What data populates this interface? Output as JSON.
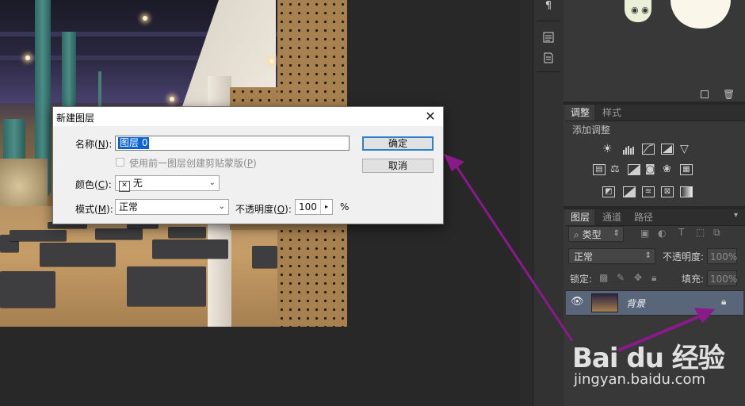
{
  "dialog": {
    "title": "新建图层",
    "name_label": "名称(",
    "name_key": "N",
    "name_label_end": "):",
    "name_value": "图层 0",
    "clip_label": "使用前一图层创建剪贴蒙版(",
    "clip_key": "P",
    "clip_label_end": ")",
    "color_label": "颜色(",
    "color_key": "C",
    "color_label_end": "):",
    "color_value": "无",
    "color_x": "✕",
    "mode_label": "模式(",
    "mode_key": "M",
    "mode_label_end": "):",
    "mode_value": "正常",
    "opacity_label": "不透明度(",
    "opacity_key": "O",
    "opacity_label_end": "):",
    "opacity_value": "100",
    "opacity_unit": "%",
    "ok_label": "确定",
    "cancel_label": "取消",
    "close_glyph": "✕"
  },
  "adjustments_panel": {
    "tabs": [
      "调整",
      "样式"
    ],
    "hint": "添加调整"
  },
  "layers_panel": {
    "tabs": [
      "图层",
      "通道",
      "路径"
    ],
    "filter_kind": "类型",
    "blend_mode": "正常",
    "opacity_label": "不透明度:",
    "opacity_value": "100%",
    "lock_label": "锁定:",
    "fill_label": "填充:",
    "fill_value": "100%",
    "layer_name": "背景"
  },
  "watermark": {
    "logo": "Bai du 经验",
    "url": "jingyan.baidu.com"
  },
  "colors": {
    "annotation_arrow": "#8a1a8a",
    "selected_layer": "#596579",
    "dialog_default_border": "#2f7fd0"
  }
}
